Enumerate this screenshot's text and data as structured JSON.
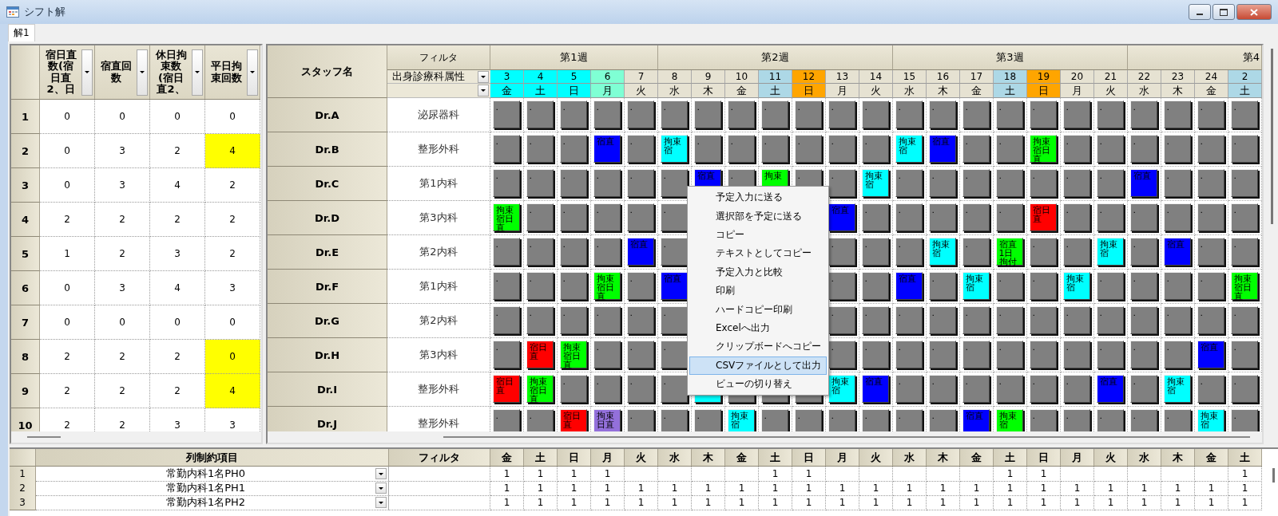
{
  "window": {
    "title": "シフト解"
  },
  "tabs": [
    {
      "label": "解1",
      "selected": true
    }
  ],
  "summary_table": {
    "columns": [
      {
        "label": "宿日直数(宿日直2、日"
      },
      {
        "label": "宿直回数"
      },
      {
        "label": "休日拘束数(宿日直2、"
      },
      {
        "label": "平日拘束回数"
      }
    ],
    "rows": [
      {
        "number": "1",
        "cells": [
          {
            "value": "0",
            "highlighted": false
          },
          {
            "value": "0",
            "highlighted": false
          },
          {
            "value": "0",
            "highlighted": false
          },
          {
            "value": "0",
            "highlighted": false
          }
        ]
      },
      {
        "number": "2",
        "cells": [
          {
            "value": "0",
            "highlighted": false
          },
          {
            "value": "3",
            "highlighted": false
          },
          {
            "value": "2",
            "highlighted": false
          },
          {
            "value": "4",
            "highlighted": true
          }
        ]
      },
      {
        "number": "3",
        "cells": [
          {
            "value": "0",
            "highlighted": false
          },
          {
            "value": "3",
            "highlighted": false
          },
          {
            "value": "4",
            "highlighted": false
          },
          {
            "value": "2",
            "highlighted": false
          }
        ]
      },
      {
        "number": "4",
        "cells": [
          {
            "value": "2",
            "highlighted": false
          },
          {
            "value": "2",
            "highlighted": false
          },
          {
            "value": "2",
            "highlighted": false
          },
          {
            "value": "2",
            "highlighted": false
          }
        ]
      },
      {
        "number": "5",
        "cells": [
          {
            "value": "1",
            "highlighted": false
          },
          {
            "value": "2",
            "highlighted": false
          },
          {
            "value": "3",
            "highlighted": false
          },
          {
            "value": "2",
            "highlighted": false
          }
        ]
      },
      {
        "number": "6",
        "cells": [
          {
            "value": "0",
            "highlighted": false
          },
          {
            "value": "3",
            "highlighted": false
          },
          {
            "value": "4",
            "highlighted": false
          },
          {
            "value": "3",
            "highlighted": false
          }
        ]
      },
      {
        "number": "7",
        "cells": [
          {
            "value": "0",
            "highlighted": false
          },
          {
            "value": "0",
            "highlighted": false
          },
          {
            "value": "0",
            "highlighted": false
          },
          {
            "value": "0",
            "highlighted": false
          }
        ]
      },
      {
        "number": "8",
        "cells": [
          {
            "value": "2",
            "highlighted": false
          },
          {
            "value": "2",
            "highlighted": false
          },
          {
            "value": "2",
            "highlighted": false
          },
          {
            "value": "0",
            "highlighted": true
          }
        ]
      },
      {
        "number": "9",
        "cells": [
          {
            "value": "2",
            "highlighted": false
          },
          {
            "value": "2",
            "highlighted": false
          },
          {
            "value": "2",
            "highlighted": false
          },
          {
            "value": "4",
            "highlighted": true
          }
        ]
      },
      {
        "number": "10",
        "cells": [
          {
            "value": "2",
            "highlighted": false
          },
          {
            "value": "2",
            "highlighted": false
          },
          {
            "value": "3",
            "highlighted": false
          },
          {
            "value": "3",
            "highlighted": false
          }
        ]
      }
    ]
  },
  "schedule": {
    "name_header": "スタッフ名",
    "filter_header": "フィルタ",
    "filter_fields": [
      {
        "kind": "dropdown",
        "value": "出身診療科属性"
      },
      {
        "kind": "dropdown"
      }
    ],
    "weeks": [
      {
        "label": "第1週",
        "days": [
          {
            "day": "3",
            "weekday": "金",
            "color": "#00ffff"
          },
          {
            "day": "4",
            "weekday": "土",
            "color": "#00ffff"
          },
          {
            "day": "5",
            "weekday": "日",
            "color": "#00ffff"
          },
          {
            "day": "6",
            "weekday": "月",
            "color": "#7fffd4"
          },
          {
            "day": "7",
            "weekday": "火",
            "color": "#e6e2d2"
          }
        ]
      },
      {
        "label": "第2週",
        "days": [
          {
            "day": "8",
            "weekday": "水",
            "color": "#e6e2d2"
          },
          {
            "day": "9",
            "weekday": "木",
            "color": "#e6e2d2"
          },
          {
            "day": "10",
            "weekday": "金",
            "color": "#e6e2d2"
          },
          {
            "day": "11",
            "weekday": "土",
            "color": "#add8e6"
          },
          {
            "day": "12",
            "weekday": "日",
            "color": "#ffa500"
          },
          {
            "day": "13",
            "weekday": "月",
            "color": "#e6e2d2"
          },
          {
            "day": "14",
            "weekday": "火",
            "color": "#e6e2d2"
          }
        ]
      },
      {
        "label": "第3週",
        "days": [
          {
            "day": "15",
            "weekday": "水",
            "color": "#e6e2d2"
          },
          {
            "day": "16",
            "weekday": "木",
            "color": "#e6e2d2"
          },
          {
            "day": "17",
            "weekday": "金",
            "color": "#e6e2d2"
          },
          {
            "day": "18",
            "weekday": "土",
            "color": "#add8e6"
          },
          {
            "day": "19",
            "weekday": "日",
            "color": "#ffa500"
          },
          {
            "day": "20",
            "weekday": "月",
            "color": "#e6e2d2"
          },
          {
            "day": "21",
            "weekday": "火",
            "color": "#e6e2d2"
          }
        ]
      },
      {
        "label": "第4",
        "days": [
          {
            "day": "22",
            "weekday": "水",
            "color": "#e6e2d2"
          },
          {
            "day": "23",
            "weekday": "木",
            "color": "#e6e2d2"
          },
          {
            "day": "24",
            "weekday": "金",
            "color": "#e6e2d2"
          },
          {
            "day": "2",
            "weekday": "土",
            "color": "#add8e6"
          }
        ]
      }
    ],
    "rows": [
      {
        "name": "Dr.A",
        "department": "泌尿器科",
        "cells": [
          {
            "text": ".",
            "color": "#808080"
          },
          {
            "text": ".",
            "color": "#808080"
          },
          {
            "text": ".",
            "color": "#808080"
          },
          {
            "text": ".",
            "color": "#808080"
          },
          {
            "text": ".",
            "color": "#808080"
          },
          {
            "text": ".",
            "color": "#808080"
          },
          {
            "text": ".",
            "color": "#808080"
          },
          {
            "text": ".",
            "color": "#808080"
          },
          {
            "text": ".",
            "color": "#808080"
          },
          {
            "text": ".",
            "color": "#808080"
          },
          {
            "text": ".",
            "color": "#808080"
          },
          {
            "text": ".",
            "color": "#808080"
          },
          {
            "text": ".",
            "color": "#808080"
          },
          {
            "text": ".",
            "color": "#808080"
          },
          {
            "text": ".",
            "color": "#808080"
          },
          {
            "text": ".",
            "color": "#808080"
          },
          {
            "text": ".",
            "color": "#808080"
          },
          {
            "text": ".",
            "color": "#808080"
          },
          {
            "text": ".",
            "color": "#808080"
          },
          {
            "text": ".",
            "color": "#808080"
          },
          {
            "text": ".",
            "color": "#808080"
          },
          {
            "text": ".",
            "color": "#808080"
          },
          {
            "text": ".",
            "color": "#808080"
          }
        ]
      },
      {
        "name": "Dr.B",
        "department": "整形外科",
        "cells": [
          {
            "text": ".",
            "color": "#808080"
          },
          {
            "text": ".",
            "color": "#808080"
          },
          {
            "text": ".",
            "color": "#808080"
          },
          {
            "text": "宿直",
            "color": "#0000ff"
          },
          {
            "text": ".",
            "color": "#808080"
          },
          {
            "text": "拘束宿",
            "color": "#00ffff"
          },
          {
            "text": ".",
            "color": "#808080"
          },
          {
            "text": ".",
            "color": "#808080"
          },
          {
            "text": ".",
            "color": "#808080"
          },
          {
            "text": ".",
            "color": "#808080"
          },
          {
            "text": ".",
            "color": "#808080"
          },
          {
            "text": ".",
            "color": "#808080"
          },
          {
            "text": "拘束宿",
            "color": "#00ffff"
          },
          {
            "text": "宿直",
            "color": "#0000ff"
          },
          {
            "text": ".",
            "color": "#808080"
          },
          {
            "text": ".",
            "color": "#808080"
          },
          {
            "text": "拘束宿日直",
            "color": "#00ff00"
          },
          {
            "text": ".",
            "color": "#808080"
          },
          {
            "text": ".",
            "color": "#808080"
          },
          {
            "text": ".",
            "color": "#808080"
          },
          {
            "text": ".",
            "color": "#808080"
          },
          {
            "text": ".",
            "color": "#808080"
          },
          {
            "text": ".",
            "color": "#808080"
          }
        ]
      },
      {
        "name": "Dr.C",
        "department": "第1内科",
        "cells": [
          {
            "text": ".",
            "color": "#808080"
          },
          {
            "text": ".",
            "color": "#808080"
          },
          {
            "text": ".",
            "color": "#808080"
          },
          {
            "text": ".",
            "color": "#808080"
          },
          {
            "text": ".",
            "color": "#808080"
          },
          {
            "text": ".",
            "color": "#808080"
          },
          {
            "text": "宿直",
            "color": "#0000ff"
          },
          {
            "text": ".",
            "color": "#808080"
          },
          {
            "text": "拘束",
            "color": "#00ff00"
          },
          {
            "text": ".",
            "color": "#808080"
          },
          {
            "text": ".",
            "color": "#808080"
          },
          {
            "text": "拘束宿",
            "color": "#00ffff"
          },
          {
            "text": ".",
            "color": "#808080"
          },
          {
            "text": ".",
            "color": "#808080"
          },
          {
            "text": ".",
            "color": "#808080"
          },
          {
            "text": ".",
            "color": "#808080"
          },
          {
            "text": ".",
            "color": "#808080"
          },
          {
            "text": ".",
            "color": "#808080"
          },
          {
            "text": ".",
            "color": "#808080"
          },
          {
            "text": "宿直",
            "color": "#0000ff"
          },
          {
            "text": ".",
            "color": "#808080"
          },
          {
            "text": ".",
            "color": "#808080"
          },
          {
            "text": ".",
            "color": "#808080"
          }
        ]
      },
      {
        "name": "Dr.D",
        "department": "第3内科",
        "cells": [
          {
            "text": "拘束宿日直",
            "color": "#00ff00"
          },
          {
            "text": ".",
            "color": "#808080"
          },
          {
            "text": ".",
            "color": "#808080"
          },
          {
            "text": ".",
            "color": "#808080"
          },
          {
            "text": ".",
            "color": "#808080"
          },
          {
            "text": ".",
            "color": "#808080"
          },
          null,
          null,
          null,
          null,
          {
            "text": "宿直",
            "color": "#0000ff"
          },
          {
            "text": ".",
            "color": "#808080"
          },
          {
            "text": ".",
            "color": "#808080"
          },
          {
            "text": ".",
            "color": "#808080"
          },
          {
            "text": ".",
            "color": "#808080"
          },
          {
            "text": ".",
            "color": "#808080"
          },
          {
            "text": "宿日直",
            "color": "#ff0000"
          },
          {
            "text": ".",
            "color": "#808080"
          },
          {
            "text": ".",
            "color": "#808080"
          },
          {
            "text": ".",
            "color": "#808080"
          },
          {
            "text": ".",
            "color": "#808080"
          },
          {
            "text": ".",
            "color": "#808080"
          },
          {
            "text": ".",
            "color": "#808080"
          }
        ]
      },
      {
        "name": "Dr.E",
        "department": "第2内科",
        "cells": [
          {
            "text": ".",
            "color": "#808080"
          },
          {
            "text": ".",
            "color": "#808080"
          },
          {
            "text": ".",
            "color": "#808080"
          },
          {
            "text": ".",
            "color": "#808080"
          },
          {
            "text": "宿直",
            "color": "#0000ff"
          },
          {
            "text": ".",
            "color": "#808080"
          },
          null,
          null,
          null,
          null,
          {
            "text": ".",
            "color": "#808080"
          },
          {
            "text": ".",
            "color": "#808080"
          },
          {
            "text": ".",
            "color": "#808080"
          },
          {
            "text": "拘束宿",
            "color": "#00ffff"
          },
          {
            "text": ".",
            "color": "#808080"
          },
          {
            "text": "宿直1日拘付",
            "color": "#00ff00"
          },
          {
            "text": ".",
            "color": "#808080"
          },
          {
            "text": ".",
            "color": "#808080"
          },
          {
            "text": "拘束宿",
            "color": "#00ffff"
          },
          {
            "text": ".",
            "color": "#808080"
          },
          {
            "text": "宿直",
            "color": "#0000ff"
          },
          {
            "text": ".",
            "color": "#808080"
          },
          {
            "text": ".",
            "color": "#808080"
          }
        ]
      },
      {
        "name": "Dr.F",
        "department": "第1内科",
        "cells": [
          {
            "text": ".",
            "color": "#808080"
          },
          {
            "text": ".",
            "color": "#808080"
          },
          {
            "text": ".",
            "color": "#808080"
          },
          {
            "text": "拘束宿日直",
            "color": "#00ff00"
          },
          {
            "text": ".",
            "color": "#808080"
          },
          {
            "text": "宿直",
            "color": "#0000ff"
          },
          null,
          null,
          null,
          null,
          {
            "text": ".",
            "color": "#808080"
          },
          {
            "text": ".",
            "color": "#808080"
          },
          {
            "text": "宿直",
            "color": "#0000ff"
          },
          {
            "text": ".",
            "color": "#808080"
          },
          {
            "text": "拘束宿",
            "color": "#00ffff"
          },
          {
            "text": ".",
            "color": "#808080"
          },
          {
            "text": ".",
            "color": "#808080"
          },
          {
            "text": "拘束宿",
            "color": "#00ffff"
          },
          {
            "text": ".",
            "color": "#808080"
          },
          {
            "text": ".",
            "color": "#808080"
          },
          {
            "text": ".",
            "color": "#808080"
          },
          {
            "text": ".",
            "color": "#808080"
          },
          {
            "text": "拘束宿日直",
            "color": "#00ff00"
          }
        ]
      },
      {
        "name": "Dr.G",
        "department": "第2内科",
        "cells": [
          {
            "text": ".",
            "color": "#808080"
          },
          {
            "text": ".",
            "color": "#808080"
          },
          {
            "text": ".",
            "color": "#808080"
          },
          {
            "text": ".",
            "color": "#808080"
          },
          {
            "text": ".",
            "color": "#808080"
          },
          {
            "text": ".",
            "color": "#808080"
          },
          null,
          null,
          null,
          null,
          {
            "text": ".",
            "color": "#808080"
          },
          {
            "text": ".",
            "color": "#808080"
          },
          {
            "text": ".",
            "color": "#808080"
          },
          {
            "text": ".",
            "color": "#808080"
          },
          {
            "text": ".",
            "color": "#808080"
          },
          {
            "text": ".",
            "color": "#808080"
          },
          {
            "text": ".",
            "color": "#808080"
          },
          {
            "text": ".",
            "color": "#808080"
          },
          {
            "text": ".",
            "color": "#808080"
          },
          {
            "text": ".",
            "color": "#808080"
          },
          {
            "text": ".",
            "color": "#808080"
          },
          {
            "text": ".",
            "color": "#808080"
          },
          {
            "text": ".",
            "color": "#808080"
          }
        ]
      },
      {
        "name": "Dr.H",
        "department": "第3内科",
        "cells": [
          {
            "text": ".",
            "color": "#808080"
          },
          {
            "text": "宿日直",
            "color": "#ff0000"
          },
          {
            "text": "拘束宿日直",
            "color": "#00ff00"
          },
          {
            "text": ".",
            "color": "#808080"
          },
          {
            "text": ".",
            "color": "#808080"
          },
          {
            "text": ".",
            "color": "#808080"
          },
          null,
          null,
          null,
          null,
          {
            "text": ".",
            "color": "#808080"
          },
          {
            "text": ".",
            "color": "#808080"
          },
          {
            "text": ".",
            "color": "#808080"
          },
          {
            "text": ".",
            "color": "#808080"
          },
          {
            "text": ".",
            "color": "#808080"
          },
          {
            "text": ".",
            "color": "#808080"
          },
          {
            "text": ".",
            "color": "#808080"
          },
          {
            "text": ".",
            "color": "#808080"
          },
          {
            "text": ".",
            "color": "#808080"
          },
          {
            "text": ".",
            "color": "#808080"
          },
          {
            "text": ".",
            "color": "#808080"
          },
          {
            "text": "宿直",
            "color": "#0000ff"
          },
          {
            "text": ".",
            "color": "#808080"
          }
        ]
      },
      {
        "name": "Dr.I",
        "department": "整形外科",
        "cells": [
          {
            "text": "宿日直",
            "color": "#ff0000"
          },
          {
            "text": "拘束宿日直",
            "color": "#00ff00"
          },
          {
            "text": ".",
            "color": "#808080"
          },
          {
            "text": ".",
            "color": "#808080"
          },
          {
            "text": ".",
            "color": "#808080"
          },
          {
            "text": ".",
            "color": "#808080"
          },
          {
            "color": "#00ffff"
          },
          {
            "color": "#808080"
          },
          {
            "color": "#808080"
          },
          {
            "color": "#808080"
          },
          {
            "text": "拘束宿",
            "color": "#00ffff"
          },
          {
            "text": "宿直",
            "color": "#0000ff"
          },
          {
            "text": ".",
            "color": "#808080"
          },
          {
            "text": ".",
            "color": "#808080"
          },
          {
            "text": ".",
            "color": "#808080"
          },
          {
            "text": ".",
            "color": "#808080"
          },
          {
            "text": ".",
            "color": "#808080"
          },
          {
            "text": ".",
            "color": "#808080"
          },
          {
            "text": "宿直",
            "color": "#0000ff"
          },
          {
            "text": ".",
            "color": "#808080"
          },
          {
            "text": "拘束宿",
            "color": "#00ffff"
          },
          {
            "text": ".",
            "color": "#808080"
          },
          {
            "text": ".",
            "color": "#808080"
          }
        ]
      },
      {
        "name": "Dr.J",
        "department": "整形外科",
        "cells": [
          {
            "text": ".",
            "color": "#808080"
          },
          {
            "text": ".",
            "color": "#808080"
          },
          {
            "text": "宿日直",
            "color": "#ff0000"
          },
          {
            "text": "拘束日直",
            "color": "#9370db"
          },
          {
            "text": ".",
            "color": "#808080"
          },
          {
            "text": ".",
            "color": "#808080"
          },
          {
            "text": ".",
            "color": "#808080"
          },
          {
            "text": "拘束宿",
            "color": "#00ffff"
          },
          {
            "text": ".",
            "color": "#808080"
          },
          {
            "text": ".",
            "color": "#808080"
          },
          {
            "text": ".",
            "color": "#808080"
          },
          {
            "text": ".",
            "color": "#808080"
          },
          {
            "text": ".",
            "color": "#808080"
          },
          {
            "text": ".",
            "color": "#808080"
          },
          {
            "text": "宿直",
            "color": "#0000ff"
          },
          {
            "text": "拘束宿",
            "color": "#00ff00"
          },
          {
            "text": ".",
            "color": "#808080"
          },
          {
            "text": ".",
            "color": "#808080"
          },
          {
            "text": ".",
            "color": "#808080"
          },
          {
            "text": ".",
            "color": "#808080"
          },
          {
            "text": ".",
            "color": "#808080"
          },
          {
            "text": "拘束宿",
            "color": "#00ffff"
          },
          {
            "text": ".",
            "color": "#808080"
          }
        ]
      }
    ]
  },
  "context_menu": {
    "items": [
      {
        "label": "予定入力に送る",
        "selected": false
      },
      {
        "label": "選択部を予定に送る",
        "selected": false
      },
      {
        "label": "コピー",
        "selected": false
      },
      {
        "label": "テキストとしてコピー",
        "selected": false
      },
      {
        "label": "予定入力と比較",
        "selected": false
      },
      {
        "label": "印刷",
        "selected": false
      },
      {
        "label": "ハードコピー印刷",
        "selected": false
      },
      {
        "label": "Excelへ出力",
        "selected": false
      },
      {
        "label": "クリップボードへコピー",
        "selected": false
      },
      {
        "label": "CSVファイルとして出力",
        "selected": true
      },
      {
        "label": "ビューの切り替え",
        "selected": false
      }
    ]
  },
  "constraint_table": {
    "item_header": "列制約項目",
    "filter_header": "フィルタ",
    "weekdays": [
      "金",
      "土",
      "日",
      "月",
      "火",
      "水",
      "木",
      "金",
      "土",
      "日",
      "月",
      "火",
      "水",
      "木",
      "金",
      "土",
      "日",
      "月",
      "火",
      "水",
      "木",
      "金",
      "土"
    ],
    "rows": [
      {
        "number": "1",
        "item": "常勤内科1名PH0",
        "cells": [
          {
            "kind": "number",
            "value": "1"
          },
          {
            "kind": "number",
            "value": "1"
          },
          {
            "kind": "number",
            "value": "1"
          },
          {
            "kind": "number",
            "value": "1"
          },
          {
            "kind": "blank"
          },
          {
            "kind": "blank"
          },
          {
            "kind": "blank"
          },
          {
            "kind": "blank"
          },
          {
            "kind": "number",
            "value": "1"
          },
          {
            "kind": "number",
            "value": "1"
          },
          {
            "kind": "blank"
          },
          {
            "kind": "blank"
          },
          {
            "kind": "blank"
          },
          {
            "kind": "blank"
          },
          {
            "kind": "blank"
          },
          {
            "kind": "number",
            "value": "1"
          },
          {
            "kind": "number",
            "value": "1"
          },
          {
            "kind": "blank"
          },
          {
            "kind": "blank"
          },
          {
            "kind": "blank"
          },
          {
            "kind": "blank"
          },
          {
            "kind": "blank"
          },
          {
            "kind": "number",
            "value": "1"
          }
        ]
      },
      {
        "number": "2",
        "item": "常勤内科1名PH1",
        "cells": [
          {
            "kind": "number",
            "value": "1"
          },
          {
            "kind": "number",
            "value": "1"
          },
          {
            "kind": "number",
            "value": "1"
          },
          {
            "kind": "number",
            "value": "1"
          },
          {
            "kind": "number",
            "value": "1"
          },
          {
            "kind": "number",
            "value": "1"
          },
          {
            "kind": "number",
            "value": "1"
          },
          {
            "kind": "number",
            "value": "1"
          },
          {
            "kind": "number",
            "value": "1"
          },
          {
            "kind": "number",
            "value": "1"
          },
          {
            "kind": "number",
            "value": "1"
          },
          {
            "kind": "number",
            "value": "1"
          },
          {
            "kind": "number",
            "value": "1"
          },
          {
            "kind": "number",
            "value": "1"
          },
          {
            "kind": "number",
            "value": "1"
          },
          {
            "kind": "number",
            "value": "1"
          },
          {
            "kind": "number",
            "value": "1"
          },
          {
            "kind": "number",
            "value": "1"
          },
          {
            "kind": "number",
            "value": "1"
          },
          {
            "kind": "number",
            "value": "1"
          },
          {
            "kind": "number",
            "value": "1"
          },
          {
            "kind": "number",
            "value": "1"
          },
          {
            "kind": "number",
            "value": "1"
          }
        ]
      },
      {
        "number": "3",
        "item": "常勤内科1名PH2",
        "cells": [
          {
            "kind": "number",
            "value": "1"
          },
          {
            "kind": "number",
            "value": "1"
          },
          {
            "kind": "number",
            "value": "1"
          },
          {
            "kind": "number",
            "value": "1"
          },
          {
            "kind": "number",
            "value": "1"
          },
          {
            "kind": "number",
            "value": "1"
          },
          {
            "kind": "number",
            "value": "1"
          },
          {
            "kind": "number",
            "value": "1"
          },
          {
            "kind": "number",
            "value": "1"
          },
          {
            "kind": "number",
            "value": "1"
          },
          {
            "kind": "number",
            "value": "1"
          },
          {
            "kind": "number",
            "value": "1"
          },
          {
            "kind": "number",
            "value": "1"
          },
          {
            "kind": "number",
            "value": "1"
          },
          {
            "kind": "number",
            "value": "1"
          },
          {
            "kind": "number",
            "value": "1"
          },
          {
            "kind": "number",
            "value": "1"
          },
          {
            "kind": "number",
            "value": "1"
          },
          {
            "kind": "number",
            "value": "1"
          },
          {
            "kind": "number",
            "value": "1"
          },
          {
            "kind": "number",
            "value": "1"
          },
          {
            "kind": "number",
            "value": "1"
          },
          {
            "kind": "number",
            "value": "1"
          }
        ]
      }
    ]
  }
}
